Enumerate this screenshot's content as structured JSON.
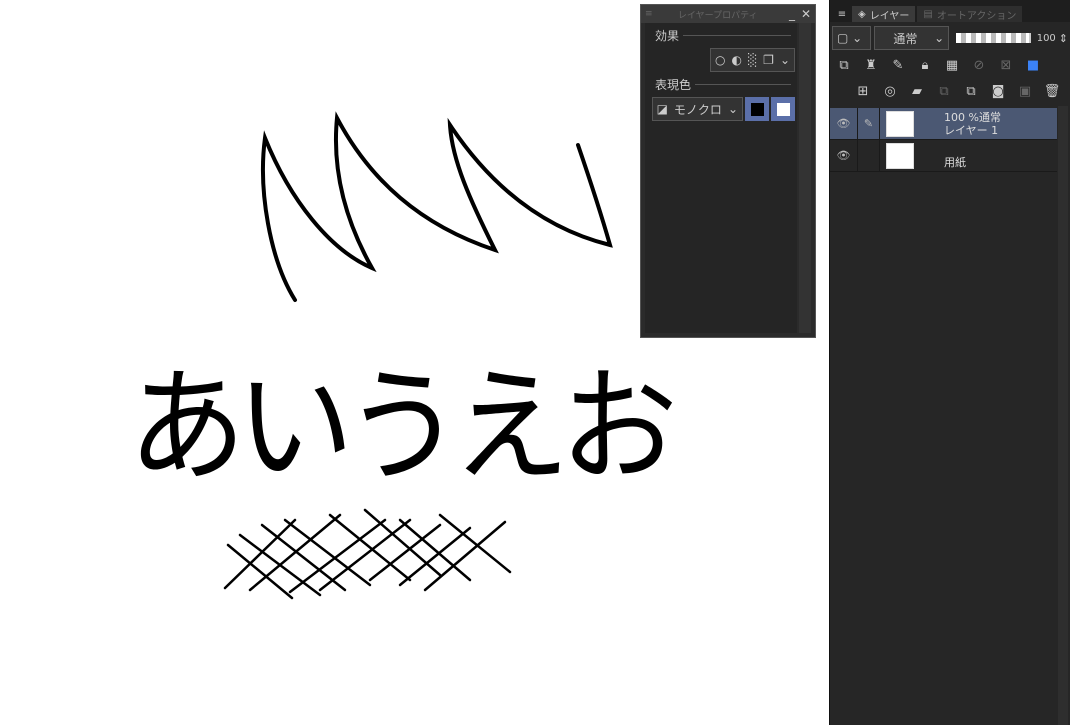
{
  "canvas": {
    "handwritten_text": "あいうえお"
  },
  "layer_property": {
    "title": "レイヤープロパティ",
    "effect_label": "効果",
    "expression_color_label": "表現色",
    "expression_color_value": "モノクロ",
    "colors": {
      "black": "#000000",
      "white": "#ffffff",
      "accent": "#5b6fa8"
    }
  },
  "layer_panel": {
    "tabs": [
      {
        "label": "レイヤー"
      },
      {
        "label": "オートアクション"
      }
    ],
    "blend_mode": "通常",
    "opacity": "100",
    "layers": [
      {
        "info": "100 %通常",
        "name": "レイヤー 1",
        "selected": true
      },
      {
        "info": "",
        "name": "用紙",
        "selected": false
      }
    ]
  }
}
